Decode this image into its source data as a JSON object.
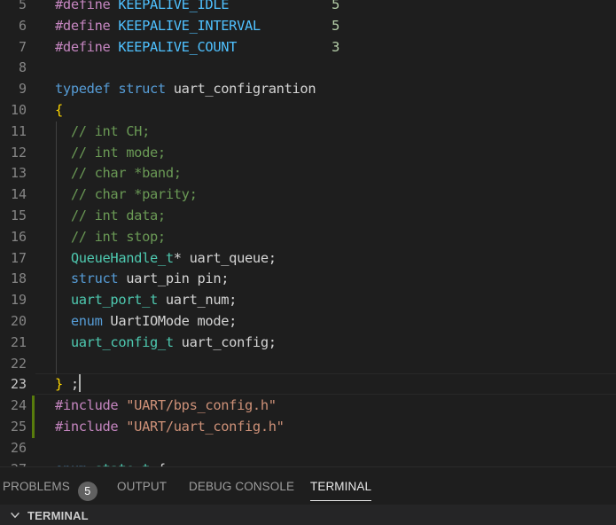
{
  "editor": {
    "active_line": "23",
    "lines": [
      {
        "num": "5",
        "segments": [
          {
            "t": "#define ",
            "c": "p"
          },
          {
            "t": "KEEPALIVE_IDLE",
            "c": "m"
          },
          {
            "t": "             ",
            "c": ""
          },
          {
            "t": "5",
            "c": "n"
          }
        ]
      },
      {
        "num": "6",
        "segments": [
          {
            "t": "#define ",
            "c": "p"
          },
          {
            "t": "KEEPALIVE_INTERVAL",
            "c": "m"
          },
          {
            "t": "         ",
            "c": ""
          },
          {
            "t": "5",
            "c": "n"
          }
        ]
      },
      {
        "num": "7",
        "segments": [
          {
            "t": "#define ",
            "c": "p"
          },
          {
            "t": "KEEPALIVE_COUNT",
            "c": "m"
          },
          {
            "t": "            ",
            "c": ""
          },
          {
            "t": "3",
            "c": "n"
          }
        ]
      },
      {
        "num": "8",
        "segments": []
      },
      {
        "num": "9",
        "segments": [
          {
            "t": "typedef",
            "c": "k"
          },
          {
            "t": " ",
            "c": ""
          },
          {
            "t": "struct",
            "c": "k"
          },
          {
            "t": " uart_configrantion",
            "c": ""
          }
        ]
      },
      {
        "num": "10",
        "segments": [
          {
            "t": "{",
            "c": "b"
          }
        ]
      },
      {
        "num": "11",
        "segments": [
          {
            "t": "  // int CH;",
            "c": "c"
          }
        ]
      },
      {
        "num": "12",
        "segments": [
          {
            "t": "  // int mode;",
            "c": "c"
          }
        ]
      },
      {
        "num": "13",
        "segments": [
          {
            "t": "  // char *band;",
            "c": "c"
          }
        ]
      },
      {
        "num": "14",
        "segments": [
          {
            "t": "  // char *parity;",
            "c": "c"
          }
        ]
      },
      {
        "num": "15",
        "segments": [
          {
            "t": "  // int data;",
            "c": "c"
          }
        ]
      },
      {
        "num": "16",
        "segments": [
          {
            "t": "  // int stop;",
            "c": "c"
          }
        ]
      },
      {
        "num": "17",
        "segments": [
          {
            "t": "  ",
            "c": ""
          },
          {
            "t": "QueueHandle_t",
            "c": "t"
          },
          {
            "t": "* uart_queue;",
            "c": ""
          }
        ]
      },
      {
        "num": "18",
        "segments": [
          {
            "t": "  ",
            "c": ""
          },
          {
            "t": "struct",
            "c": "k"
          },
          {
            "t": " uart_pin pin;",
            "c": ""
          }
        ]
      },
      {
        "num": "19",
        "segments": [
          {
            "t": "  ",
            "c": ""
          },
          {
            "t": "uart_port_t",
            "c": "t"
          },
          {
            "t": " uart_num;",
            "c": ""
          }
        ]
      },
      {
        "num": "20",
        "segments": [
          {
            "t": "  ",
            "c": ""
          },
          {
            "t": "enum",
            "c": "k"
          },
          {
            "t": " UartIOMode mode;",
            "c": ""
          }
        ]
      },
      {
        "num": "21",
        "segments": [
          {
            "t": "  ",
            "c": ""
          },
          {
            "t": "uart_config_t",
            "c": "t"
          },
          {
            "t": " uart_config;",
            "c": ""
          }
        ]
      },
      {
        "num": "22",
        "segments": []
      },
      {
        "num": "23",
        "segments": [
          {
            "t": "}",
            "c": "b"
          },
          {
            "t": " ;",
            "c": ""
          }
        ]
      },
      {
        "num": "24",
        "segments": [
          {
            "t": "#include ",
            "c": "p"
          },
          {
            "t": "\"UART/bps_config.h\"",
            "c": "s"
          }
        ]
      },
      {
        "num": "25",
        "segments": [
          {
            "t": "#include ",
            "c": "p"
          },
          {
            "t": "\"UART/uart_config.h\"",
            "c": "s"
          }
        ]
      },
      {
        "num": "26",
        "segments": []
      },
      {
        "num": "27",
        "segments": [
          {
            "t": "enum",
            "c": "k"
          },
          {
            "t": " ",
            "c": ""
          },
          {
            "t": "state_t",
            "c": "t"
          },
          {
            "t": " {",
            "c": ""
          }
        ]
      }
    ]
  },
  "panel": {
    "tabs": {
      "problems": "PROBLEMS",
      "problems_count": "5",
      "output": "OUTPUT",
      "debug_console": "DEBUG CONSOLE",
      "terminal": "TERMINAL"
    },
    "section_title": "TERMINAL"
  },
  "colors": {
    "keyword": "#569cd6",
    "macro": "#4fc1ff",
    "type": "#4ec9b0",
    "number": "#b5cea8",
    "comment": "#6a9955",
    "string": "#ce9178",
    "preprocessor": "#c586c0",
    "bracket": "#ffd700",
    "git_added": "#587c0c"
  }
}
